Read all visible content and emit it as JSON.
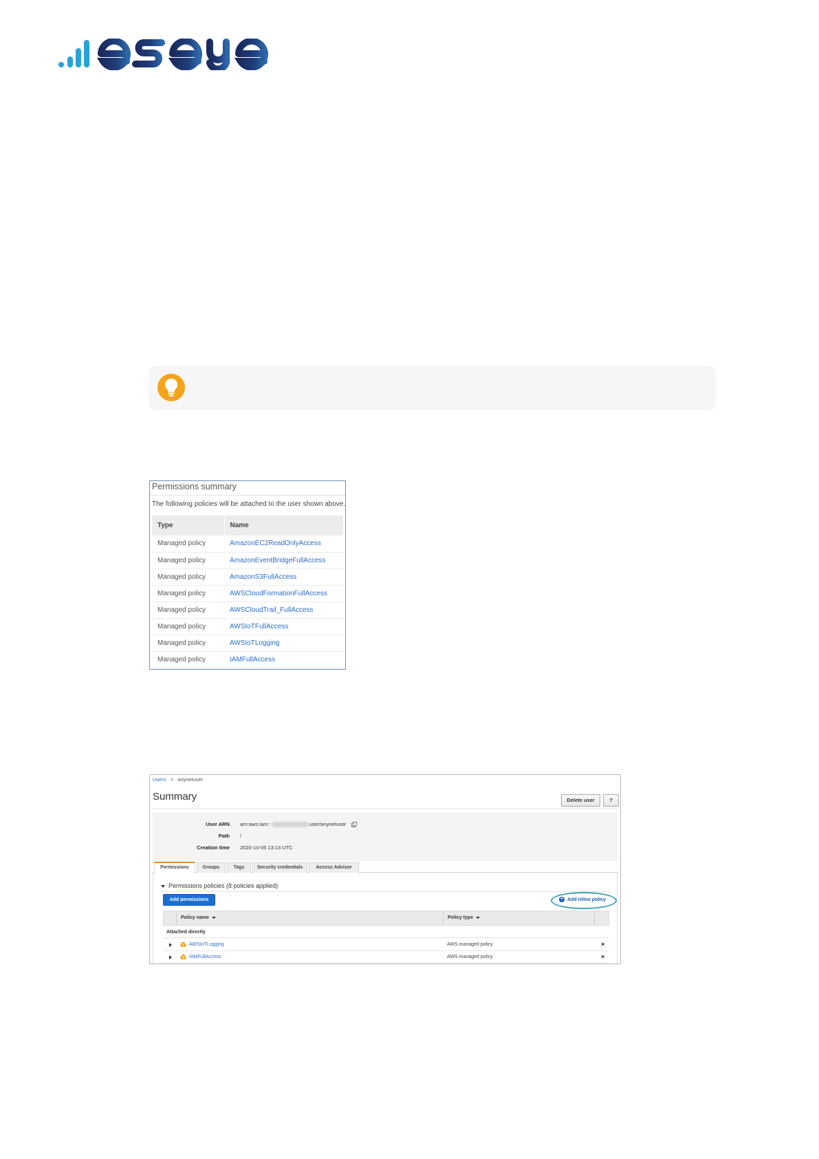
{
  "brand": {
    "logo_text": "eseye"
  },
  "permissions_summary": {
    "title": "Permissions summary",
    "description": "The following policies will be attached to the user shown above.",
    "columns": [
      "Type",
      "Name"
    ],
    "rows": [
      {
        "type": "Managed policy",
        "name": "AmazonEC2ReadOnlyAccess"
      },
      {
        "type": "Managed policy",
        "name": "AmazonEventBridgeFullAccess"
      },
      {
        "type": "Managed policy",
        "name": "AmazonS3FullAccess"
      },
      {
        "type": "Managed policy",
        "name": "AWSCloudFormationFullAccess"
      },
      {
        "type": "Managed policy",
        "name": "AWSCloudTrail_FullAccess"
      },
      {
        "type": "Managed policy",
        "name": "AWSIoTFullAccess"
      },
      {
        "type": "Managed policy",
        "name": "AWSIoTLogging"
      },
      {
        "type": "Managed policy",
        "name": "IAMFullAccess"
      }
    ]
  },
  "aws_summary": {
    "breadcrumb": {
      "parent": "Users",
      "separator": ">",
      "current": "anynetuser"
    },
    "title": "Summary",
    "delete_label": "Delete user",
    "help_label": "?",
    "fields": {
      "arn_label": "User ARN",
      "arn_prefix": "arn:aws:iam::",
      "arn_suffix": "user/anynetuser",
      "path_label": "Path",
      "path_value": "/",
      "created_label": "Creation time",
      "created_value": "2020-10-05 13:13 UTC"
    },
    "tabs": [
      "Permissions",
      "Groups",
      "Tags",
      "Security credentials",
      "Access Advisor"
    ],
    "policies_header": "Permissions policies (8 policies applied)",
    "add_permissions_label": "Add permissions",
    "add_inline_label": "Add inline policy",
    "columns": {
      "policy_name": "Policy name",
      "policy_type": "Policy type"
    },
    "group_label": "Attached directly",
    "rows": [
      {
        "name": "AWSIoTLogging",
        "type": "AWS managed policy",
        "remove": "×"
      },
      {
        "name": "IAMFullAccess",
        "type": "AWS managed policy",
        "remove": "×"
      }
    ]
  },
  "colors": {
    "brand_dark": "#1b2a5e",
    "brand_light": "#29a3d6",
    "link": "#2c6dc4",
    "tip_bulb": "#f5a31a",
    "highlight_ring": "#3ea3b0"
  }
}
